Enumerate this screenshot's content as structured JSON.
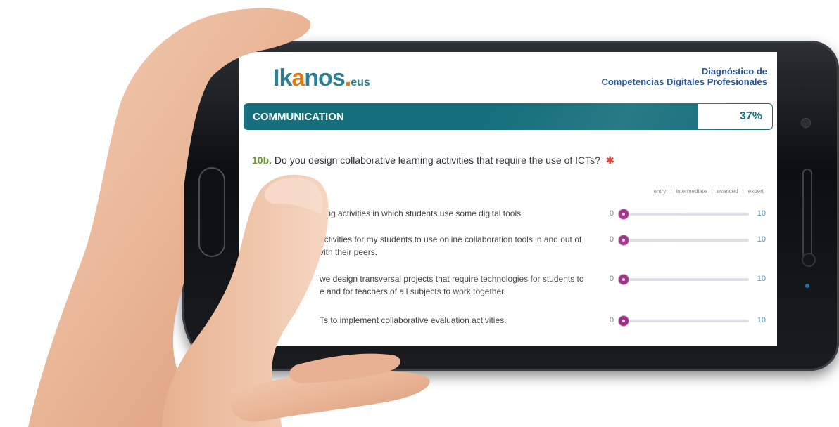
{
  "header": {
    "logo_main": "Ik",
    "logo_o": "a",
    "logo_rest": "nos",
    "logo_dot": ".",
    "logo_suffix": "eus",
    "title_line1": "Diagnóstico de",
    "title_line2": "Competencias Digitales Profesionales"
  },
  "section": {
    "label": "COMMUNICATION",
    "progress_label": "37%",
    "progress_fraction": 0.86
  },
  "question": {
    "number": "10b.",
    "text": "Do you design collaborative learning activities that require the use of ICTs?",
    "required_mark": "✱"
  },
  "scale": {
    "levels": [
      "entry",
      "intermediate",
      "avanced",
      "expert"
    ],
    "separator": "|"
  },
  "options": [
    {
      "text_line1": "ning activities in which students use some digital tools.",
      "text_line2": "",
      "min": "0",
      "max": "10",
      "value": 0
    },
    {
      "text_line1": "activities for my students to use online collaboration tools in and out of",
      "text_line2": "vith their peers.",
      "min": "0",
      "max": "10",
      "value": 0
    },
    {
      "text_line1": "we design transversal projects that require technologies for students to",
      "text_line2": "e and for teachers of all subjects to work together.",
      "min": "0",
      "max": "10",
      "value": 0
    },
    {
      "text_line1": "Ts to implement collaborative evaluation activities.",
      "text_line2": "",
      "min": "0",
      "max": "10",
      "value": 0
    }
  ],
  "colors": {
    "accent_teal": "#156f7c",
    "title_blue": "#1f4e96",
    "logo_orange": "#e07a1a",
    "slider_thumb": "#9c2f86",
    "required_red": "#e2352a"
  }
}
